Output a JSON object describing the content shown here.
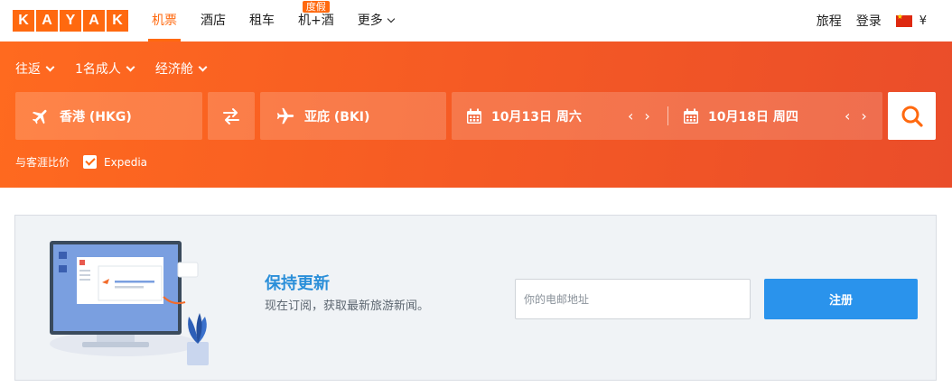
{
  "brand": {
    "letters": [
      "K",
      "A",
      "Y",
      "A",
      "K"
    ],
    "color": "#ff690f"
  },
  "nav": {
    "items": [
      {
        "label": "机票",
        "active": true
      },
      {
        "label": "酒店"
      },
      {
        "label": "租车"
      },
      {
        "label": "机+酒",
        "badge": "度假"
      },
      {
        "label": "更多",
        "dropdown": true
      }
    ]
  },
  "header_right": {
    "trips": "旅程",
    "login": "登录",
    "flag_icon": "china-flag-icon",
    "currency": "¥"
  },
  "search": {
    "trip_type": "往返",
    "travelers": "1名成人",
    "cabin": "经济舱",
    "origin": "香港 (HKG)",
    "destination": "亚庇 (BKI)",
    "depart_date": "10月13日 周六",
    "return_date": "10月18日 周四",
    "prev_arrow": "‹",
    "next_arrow": "›",
    "compare_label": "与客涯比价",
    "compare_option": "Expedia",
    "compare_checked": true
  },
  "newsletter": {
    "title": "保持更新",
    "subtitle": "现在订阅，获取最新旅游新闻。",
    "email_placeholder": "你的电邮地址",
    "signup_label": "注册"
  },
  "colors": {
    "hero_start": "#ff6a1f",
    "hero_end": "#ea4d2a",
    "signup": "#2a93ec",
    "title": "#2b8fd9"
  }
}
